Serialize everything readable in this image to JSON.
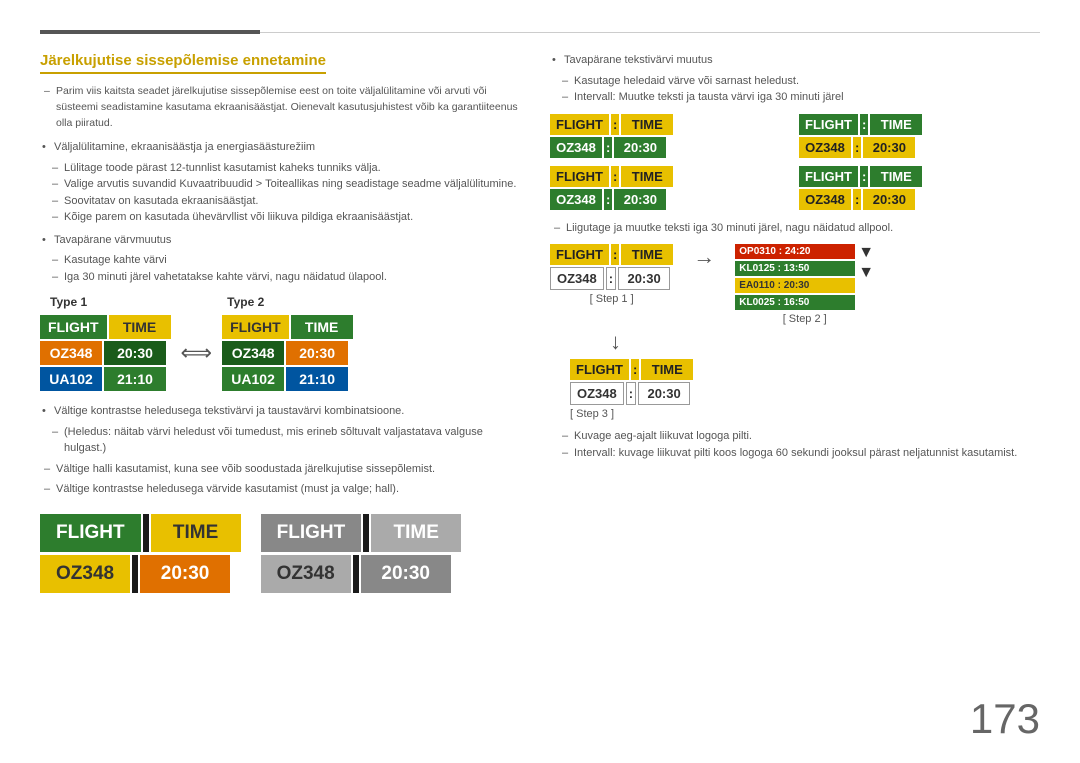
{
  "page": {
    "number": "173"
  },
  "header": {
    "title": "Järelkujutise sissepõlemise ennetamine"
  },
  "left": {
    "intro": "Parim viis kaitsta seadet järelkujutise sissepõlemise eest on toite väljalülitamine või arvuti või süsteemi seadistamine kasutama ekraanisäästjat. Oienevalt kasutusjuhistest võib ka garantiiteenus olla piiratud.",
    "bullet1": "Väljalülitamine, ekraanisäästja ja energiasäästurežiim",
    "sub1_1": "Lülitage toode pärast 12-tunnlist kasutamist kaheks tunniks välja.",
    "sub1_2": "Valige arvutis suvandid Kuvaatribuudid > Toiteallikas ning seadistage seadme väljalülitumine.",
    "sub1_3": "Soovitatav on kasutada ekraanisäästjat.",
    "sub1_4": "Kõige parem on kasutada ühevärvllist või liikuva pildiga ekraanisäästjat.",
    "bullet2": "Tavapärane värvmuutus",
    "sub2_1": "Kasutage kahte värvi",
    "sub2_2": "Iga 30 minuti järel vahetatakse kahte värvi, nagu näidatud ülapool.",
    "type1_label": "Type 1",
    "type2_label": "Type 2",
    "bullet3": "Vältige kontrastse heledusega tekstivärvi ja taustavärvi kombinatsioone.",
    "sub3_1": "(Heledus: näitab värvi heledust või tumedust, mis erineb sõltuvalt valjastatava valguse hulgast.)",
    "note1": "Vältige halli kasutamist, kuna see võib soodustada järelkujutise sissepõlemist.",
    "note2": "Vältige kontrastse heledusega värvide kasutamist (must ja valge; hall).",
    "display1": {
      "header_left": "FLIGHT",
      "header_right": "TIME",
      "row1_left": "OZ348",
      "row1_right": "20:30",
      "style": "green-yellow"
    },
    "display2": {
      "header_left": "FLIGHT",
      "header_right": "TIME",
      "row1_left": "OZ348",
      "row1_right": "20:30",
      "style": "gray"
    }
  },
  "type1": {
    "flight": "FLIGHT",
    "time": "TIME",
    "oz348": "OZ348",
    "t2030": "20:30",
    "ua102": "UA102",
    "t2110": "21:10"
  },
  "type2": {
    "flight": "FLIGHT",
    "time": "TIME",
    "oz348": "OZ348",
    "t2030": "20:30",
    "ua102": "UA102",
    "t2110": "21:10"
  },
  "right": {
    "bullet1": "Tavapärane tekstivärvi muutus",
    "sub1_1": "Kasutage heledaid värve või sarnast heledust.",
    "sub1_2": "Intervall: Muutke teksti ja tausta värvi iga 30 minuti järel",
    "grid": [
      {
        "header_left": "FLIGHT",
        "sep": ":",
        "header_right": "TIME",
        "row_left": "OZ348",
        "row_sep": ":",
        "row_right": "20:30",
        "style": "yg"
      },
      {
        "header_left": "FLIGHT",
        "sep": ":",
        "header_right": "TIME",
        "row_left": "OZ348",
        "row_sep": ":",
        "row_right": "20:30",
        "style": "gy"
      },
      {
        "header_left": "FLIGHT",
        "sep": ":",
        "header_right": "TIME",
        "row_left": "OZ348",
        "row_sep": ":",
        "row_right": "20:30",
        "style": "yg"
      },
      {
        "header_left": "FLIGHT",
        "sep": ":",
        "header_right": "TIME",
        "row_left": "OZ348",
        "row_sep": ":",
        "row_right": "20:30",
        "style": "gy"
      }
    ],
    "note_dash": "Liigutage ja muutke teksti iga 30 minuti järel, nagu näidatud allpool.",
    "step1_label": "[ Step 1 ]",
    "step2_label": "[ Step 2 ]",
    "step3_label": "[ Step 3 ]",
    "step1": {
      "header_left": "FLIGHT",
      "header_right": "TIME",
      "row_left": "OZ348",
      "row_right": "20:30"
    },
    "step2_lines": [
      {
        "text": "OP0310 : 24:20",
        "style": "red"
      },
      {
        "text": "KL0125 : 13:50",
        "style": "green"
      },
      {
        "text": "EA0110 : 20:30",
        "style": "yellow"
      },
      {
        "text": "KL0025 : 16:50",
        "style": "green"
      }
    ],
    "step3": {
      "header_left": "FLIGHT",
      "header_right": "TIME",
      "row_left": "OZ348",
      "row_right": "20:30"
    },
    "note_logo": "Kuvage aeg-ajalt liikuvat logoga pilti.",
    "note_logo2": "Intervall: kuvage liikuvat pilti koos logoga 60 sekundi jooksul pärast neljatunnist kasutamist."
  }
}
